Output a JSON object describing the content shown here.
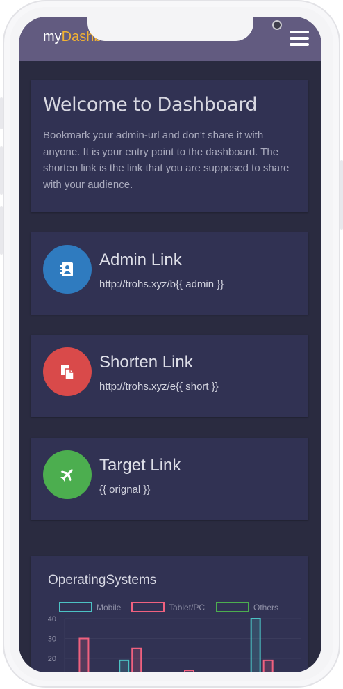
{
  "navbar": {
    "brand_prefix": "my",
    "brand_highlight": "Dashboard"
  },
  "welcome": {
    "title": "Welcome to Dashboard",
    "text": "Bookmark your admin-url and don't share it with anyone. It is your entry point to the dashboard. The shorten link is the link that you are supposed to share with your audience."
  },
  "links": [
    {
      "title": "Admin Link",
      "value": "http://trohs.xyz/b{{ admin }}",
      "icon": "contact-book-icon",
      "color": "#2f7bbf"
    },
    {
      "title": "Shorten Link",
      "value": "http://trohs.xyz/e{{ short }}",
      "icon": "copy-document-icon",
      "color": "#d94a4a"
    },
    {
      "title": "Target Link",
      "value": "{{ orignal }}",
      "icon": "airplane-icon",
      "color": "#4cae4f"
    }
  ],
  "chart": {
    "title": "OperatingSystems",
    "chart_data": {
      "type": "bar",
      "title": "OperatingSystems",
      "series": [
        {
          "name": "Mobile",
          "color": "#4cc2c4",
          "values": [
            0,
            0,
            19,
            0,
            0,
            0,
            0,
            40,
            0
          ]
        },
        {
          "name": "Tablet/PC",
          "color": "#f0617f",
          "values": [
            30,
            0,
            25,
            0,
            14,
            0,
            0,
            19,
            0
          ]
        },
        {
          "name": "Others",
          "color": "#4cae4f",
          "values": []
        }
      ],
      "ylim": [
        0,
        40
      ],
      "yticks": [
        40,
        30,
        20
      ],
      "legend": "top",
      "grid": true
    }
  }
}
